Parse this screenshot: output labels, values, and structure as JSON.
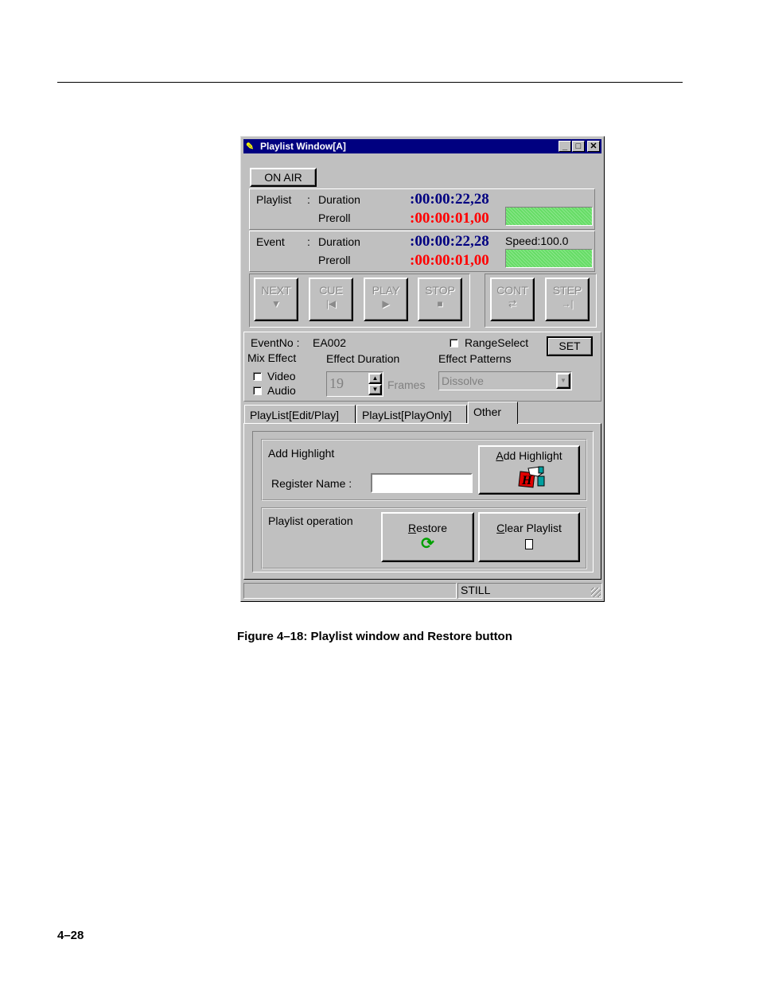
{
  "window": {
    "title": "Playlist Window[A]",
    "minimize": "_",
    "maximize": "□",
    "close": "✕"
  },
  "on_air_label": "ON AIR",
  "playlist_block": {
    "label": "Playlist",
    "sep": ":",
    "duration_label": "Duration",
    "preroll_label": "Preroll",
    "duration_value": ":00:00:22,28",
    "preroll_value": ":00:00:01,00"
  },
  "event_block": {
    "label": "Event",
    "sep": ":",
    "duration_label": "Duration",
    "preroll_label": "Preroll",
    "duration_value": ":00:00:22,28",
    "preroll_value": ":00:00:01,00",
    "speed": "Speed:100.0"
  },
  "transport": [
    {
      "label": "NEXT",
      "glyph": "▼"
    },
    {
      "label": "CUE",
      "glyph": "|◀"
    },
    {
      "label": "PLAY",
      "glyph": "▶"
    },
    {
      "label": "STOP",
      "glyph": "■"
    },
    {
      "label": "CONT",
      "glyph": "⇄"
    },
    {
      "label": "STEP",
      "glyph": "→|"
    }
  ],
  "event_info": {
    "eventno_label": "EventNo :",
    "eventno_value": "EA002",
    "range_select_label": "RangeSelect",
    "set_label": "SET",
    "mix_effect_label": "Mix Effect",
    "effect_duration_label": "Effect Duration",
    "effect_patterns_label": "Effect Patterns",
    "video_label": "Video",
    "audio_label": "Audio",
    "frames_value": "19",
    "frames_label": "Frames",
    "pattern_value": "Dissolve"
  },
  "tabs": [
    "PlayList[Edit/Play]",
    "PlayList[PlayOnly]",
    "Other"
  ],
  "add_highlight": {
    "group_label": "Add Highlight",
    "register_name_label": "Register Name :",
    "register_name_value": "",
    "button_label_rest": "dd Highlight",
    "button_label_accel": "A"
  },
  "playlist_operation": {
    "group_label": "Playlist operation",
    "restore_accel": "R",
    "restore_rest": "estore",
    "clear_accel": "C",
    "clear_rest": "lear Playlist"
  },
  "status": {
    "left": "",
    "mode": "STILL"
  },
  "caption": "Figure 4–18: Playlist window and Restore button",
  "page_number": "4–28"
}
